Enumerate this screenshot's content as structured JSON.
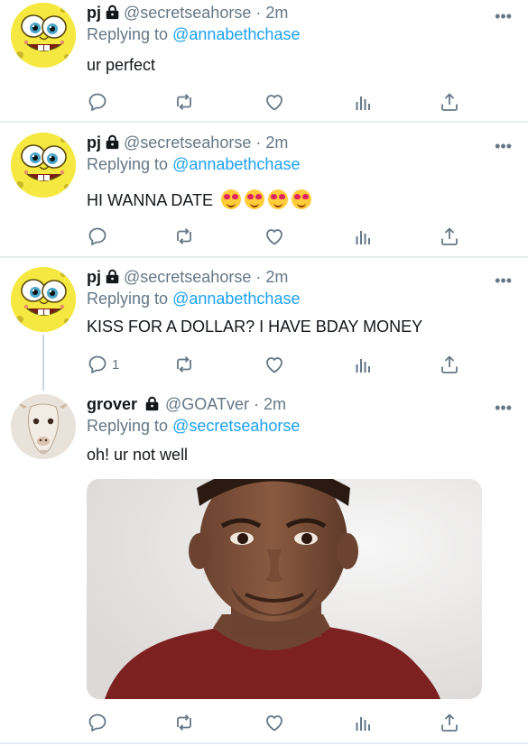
{
  "tweets": [
    {
      "name": "pj",
      "handle": "@secretseahorse",
      "dot": "·",
      "time": "2m",
      "replying_prefix": "Replying to",
      "replying_to": "@annabethchase",
      "text": "ur perfect",
      "reply_count": "",
      "avatar": "spongebob-avatar"
    },
    {
      "name": "pj",
      "handle": "@secretseahorse",
      "dot": "·",
      "time": "2m",
      "replying_prefix": "Replying to",
      "replying_to": "@annabethchase",
      "text": "HI WANNA DATE",
      "emojis": [
        "heart-eyes-emoji",
        "heart-eyes-emoji",
        "heart-eyes-emoji",
        "heart-eyes-emoji"
      ],
      "reply_count": "",
      "avatar": "spongebob-avatar"
    },
    {
      "name": "pj",
      "handle": "@secretseahorse",
      "dot": "·",
      "time": "2m",
      "replying_prefix": "Replying to",
      "replying_to": "@annabethchase",
      "text": "KISS FOR A DOLLAR? I HAVE BDAY MONEY",
      "reply_count": "1",
      "avatar": "spongebob-avatar"
    },
    {
      "name": "grover",
      "handle": "@GOATver",
      "dot": "·",
      "time": "2m",
      "replying_prefix": "Replying to",
      "replying_to": "@secretseahorse",
      "text": "oh! ur not well",
      "reply_count": "",
      "avatar": "goat-avatar",
      "media": "smiling-man-photo"
    }
  ],
  "more_label": "•••",
  "icons": [
    "reply-icon",
    "retweet-icon",
    "like-icon",
    "analytics-icon",
    "share-icon",
    "lock-icon"
  ],
  "colors": {
    "link": "#1da1f2",
    "muted": "#657786",
    "divider": "#e6ecf0",
    "text": "#14171a"
  }
}
